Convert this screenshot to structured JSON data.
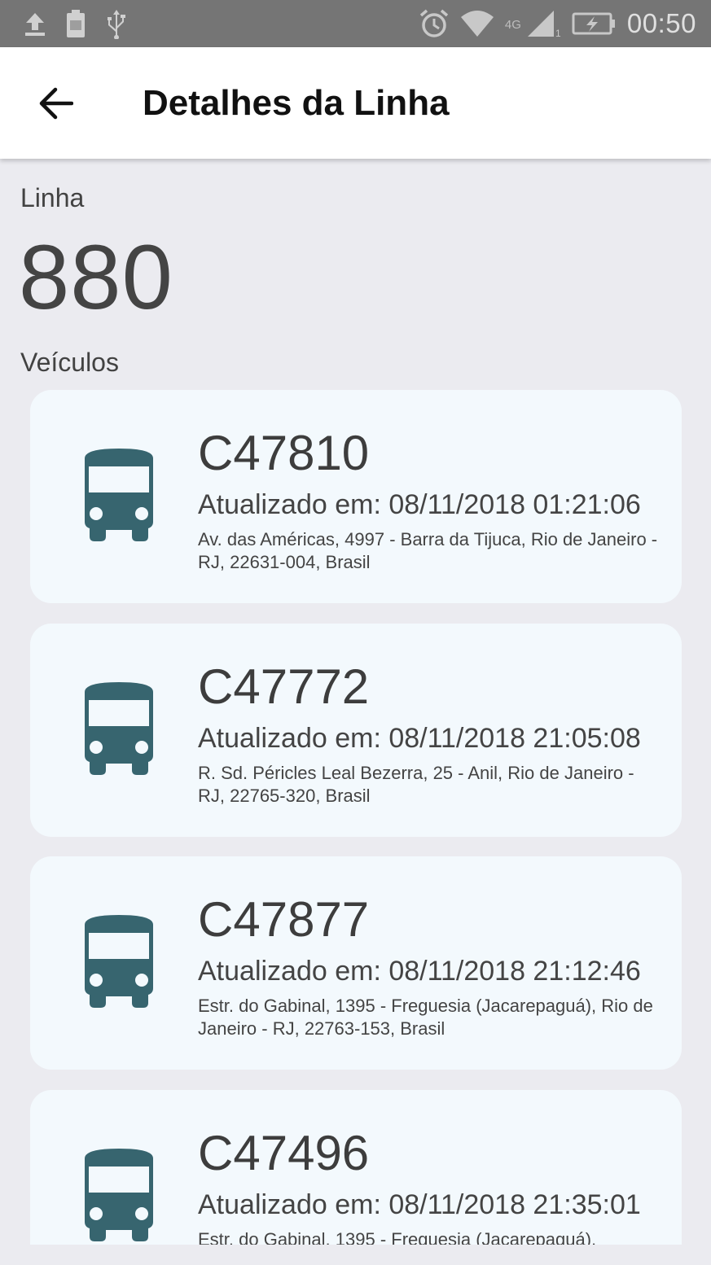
{
  "status_bar": {
    "time": "00:50",
    "network": "4G",
    "signal_sub": "1",
    "icons": [
      "upload-icon",
      "battery-saver-icon",
      "usb-icon",
      "alarm-icon",
      "wifi-icon",
      "cell-signal-icon",
      "battery-charging-icon"
    ]
  },
  "app_bar": {
    "title": "Detalhes da Linha",
    "back_icon": "arrow-back-icon"
  },
  "line": {
    "label": "Linha",
    "number": "880"
  },
  "vehicles_label": "Veículos",
  "vehicles": [
    {
      "id": "C47810",
      "updated": "Atualizado em: 08/11/2018 01:21:06",
      "address": "Av. das Américas, 4997 - Barra da Tijuca, Rio de Janeiro - RJ, 22631-004, Brasil",
      "icon": "bus-icon"
    },
    {
      "id": "C47772",
      "updated": "Atualizado em: 08/11/2018 21:05:08",
      "address": "R. Sd. Péricles Leal Bezerra, 25 - Anil, Rio de Janeiro - RJ, 22765-320, Brasil",
      "icon": "bus-icon"
    },
    {
      "id": "C47877",
      "updated": "Atualizado em: 08/11/2018 21:12:46",
      "address": "Estr. do Gabinal, 1395 - Freguesia (Jacarepaguá), Rio de Janeiro - RJ, 22763-153, Brasil",
      "icon": "bus-icon"
    },
    {
      "id": "C47496",
      "updated": "Atualizado em: 08/11/2018 21:35:01",
      "address": "Estr. do Gabinal, 1395 - Freguesia (Jacarepaguá),",
      "icon": "bus-icon"
    }
  ],
  "colors": {
    "status_bar": "#757575",
    "background": "#ebebf0",
    "card": "#f3f9fd",
    "bus_icon": "#37656f"
  }
}
